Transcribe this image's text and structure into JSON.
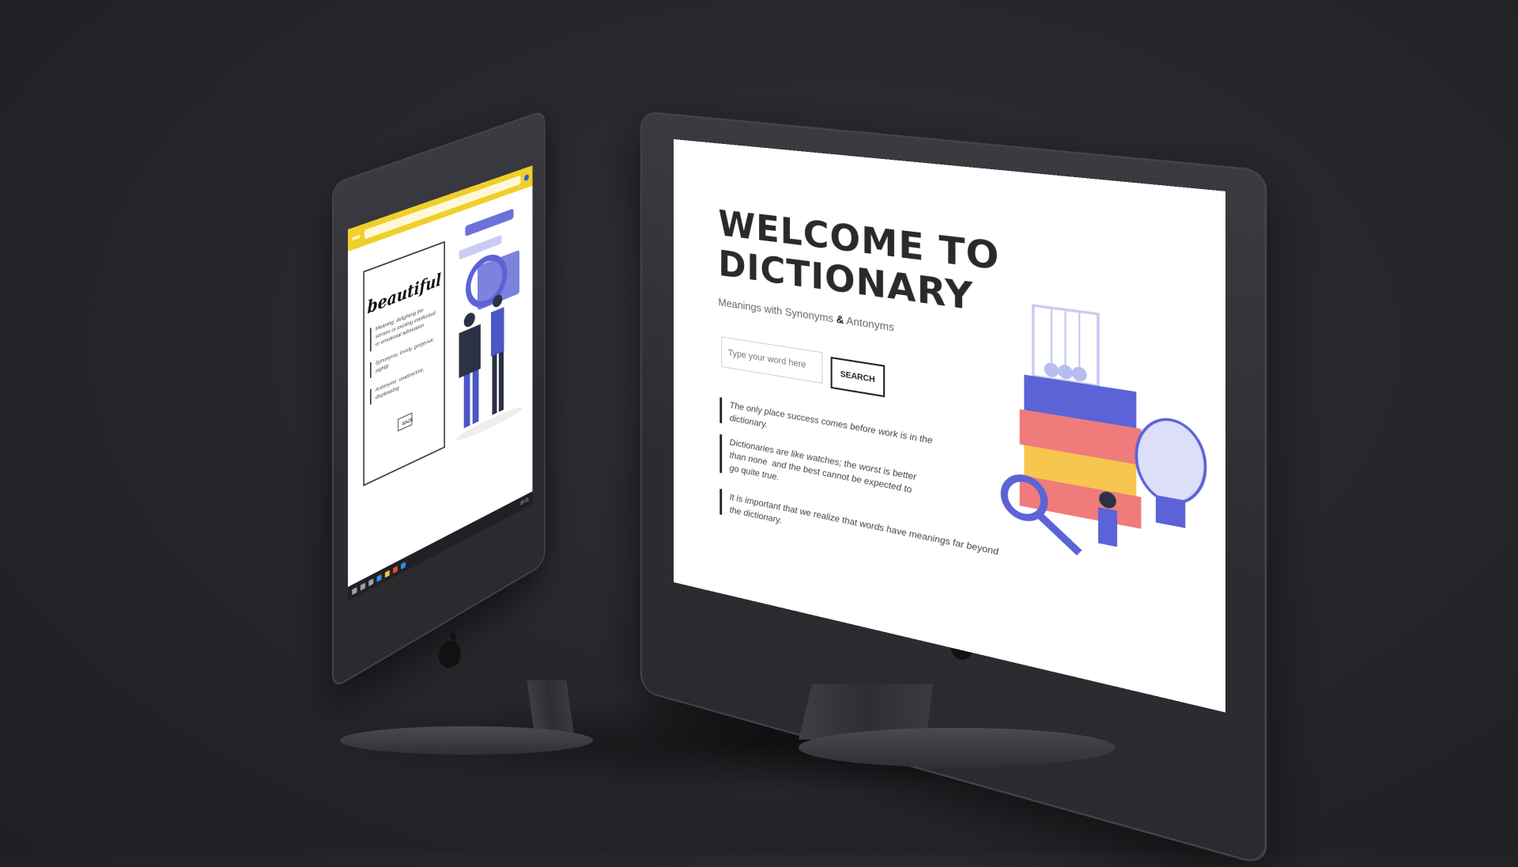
{
  "left_screen": {
    "browser": {
      "tab_label": "",
      "url": ""
    },
    "card": {
      "word": "beautiful",
      "meaning": "Meaning: delighting the senses or exciting intellectual or emotional admiration",
      "synonyms": "Synonyms: lovely, gorgeous, sightly",
      "antonyms": "Antonyms: unattractive, displeasing",
      "back_label": "BACK"
    },
    "taskbar": {
      "time": "15:21"
    }
  },
  "right_screen": {
    "title_line1": "WELCOME TO",
    "title_line2": "DICTIONARY",
    "subtitle_part1": "Meanings with Synonyms ",
    "subtitle_amp": "&",
    "subtitle_part2": " Antonyms",
    "search": {
      "placeholder": "Type your word here",
      "button_label": "SEARCH"
    },
    "quotes": [
      "The only place success comes before work is in the  dictionary.",
      "Dictionaries are like watches; the worst is better than none  and the best cannot be expected to go quite true.",
      "It is important that we realize that words have meanings far beyond the dictionary."
    ]
  },
  "colors": {
    "accent_yellow": "#f1cf2a",
    "illustration_blue": "#5b63d6",
    "illustration_pink": "#f07b7b",
    "background": "#25262a"
  }
}
